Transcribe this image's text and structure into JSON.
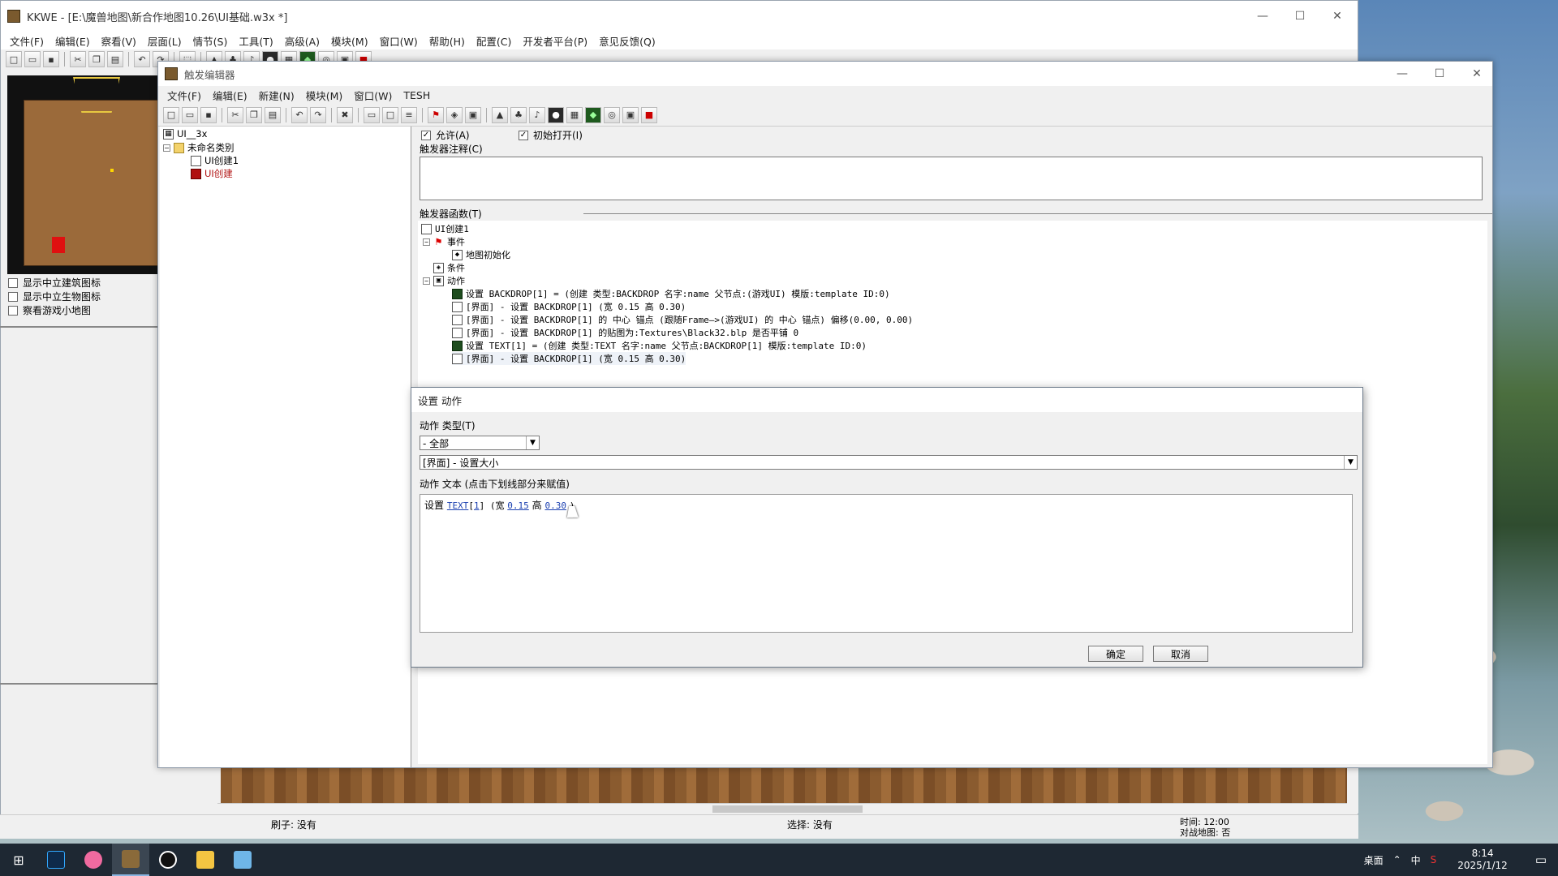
{
  "main": {
    "title": "KKWE - [E:\\魔兽地图\\新合作地图10.26\\UI基础.w3x *]",
    "menu": [
      "文件(F)",
      "编辑(E)",
      "察看(V)",
      "层面(L)",
      "情节(S)",
      "工具(T)",
      "高级(A)",
      "模块(M)",
      "窗口(W)",
      "帮助(H)",
      "配置(C)",
      "开发者平台(P)",
      "意见反馈(Q)"
    ],
    "checks": [
      "显示中立建筑图标",
      "显示中立生物图标",
      "察看游戏小地图"
    ],
    "status": {
      "brush": "刷子: 没有",
      "select": "选择: 没有",
      "time": "时间: 12:00",
      "melee": "对战地图: 否"
    }
  },
  "trigger": {
    "title": "触发编辑器",
    "menu": [
      "文件(F)",
      "编辑(E)",
      "新建(N)",
      "模块(M)",
      "窗口(W)",
      "TESH"
    ],
    "tree": {
      "root": "UI__3x",
      "category": "未命名类别",
      "item1": "UI创建1",
      "item2": "UI创建"
    },
    "enabled": "允许(A)",
    "initially_on": "初始打开(I)",
    "comment_label": "触发器注释(C)",
    "functions_label": "触发器函数(T)",
    "func": {
      "root": "UI创建1",
      "events": "事件",
      "event1": "地图初始化",
      "conditions": "条件",
      "actions": "动作",
      "a1": "设置 BACKDROP[1] = (创建 类型:BACKDROP 名字:name 父节点:(游戏UI) 模版:template ID:0)",
      "a2": "[界面] - 设置 BACKDROP[1] (宽 0.15 高 0.30)",
      "a3": "[界面] - 设置 BACKDROP[1] 的 中心 锚点 (跟随Frame—>(游戏UI) 的 中心 锚点) 偏移(0.00, 0.00)",
      "a4": "[界面] - 设置 BACKDROP[1] 的贴图为:Textures\\Black32.blp 是否平铺 0",
      "a5": "设置 TEXT[1] = (创建 类型:TEXT 名字:name 父节点:BACKDROP[1] 模版:template ID:0)",
      "a6": "[界面] - 设置 BACKDROP[1] (宽 0.15 高 0.30)"
    }
  },
  "dialog": {
    "title": "设置 动作",
    "type_label": "动作 类型(T)",
    "type_value": "- 全部",
    "action_value": "[界面] - 设置大小",
    "text_label": "动作 文本 (点击下划线部分来赋值)",
    "text_prefix": "设置",
    "link_text": "TEXT",
    "link_index": "1",
    "mid1": "] (宽",
    "width": "0.15",
    "mid2": "高",
    "height": "0.30",
    "suffix": ")",
    "ok": "确定",
    "cancel": "取消"
  },
  "taskbar": {
    "desktop": "桌面",
    "ime": "中",
    "time": "8:14",
    "date": "2025/1/12"
  }
}
